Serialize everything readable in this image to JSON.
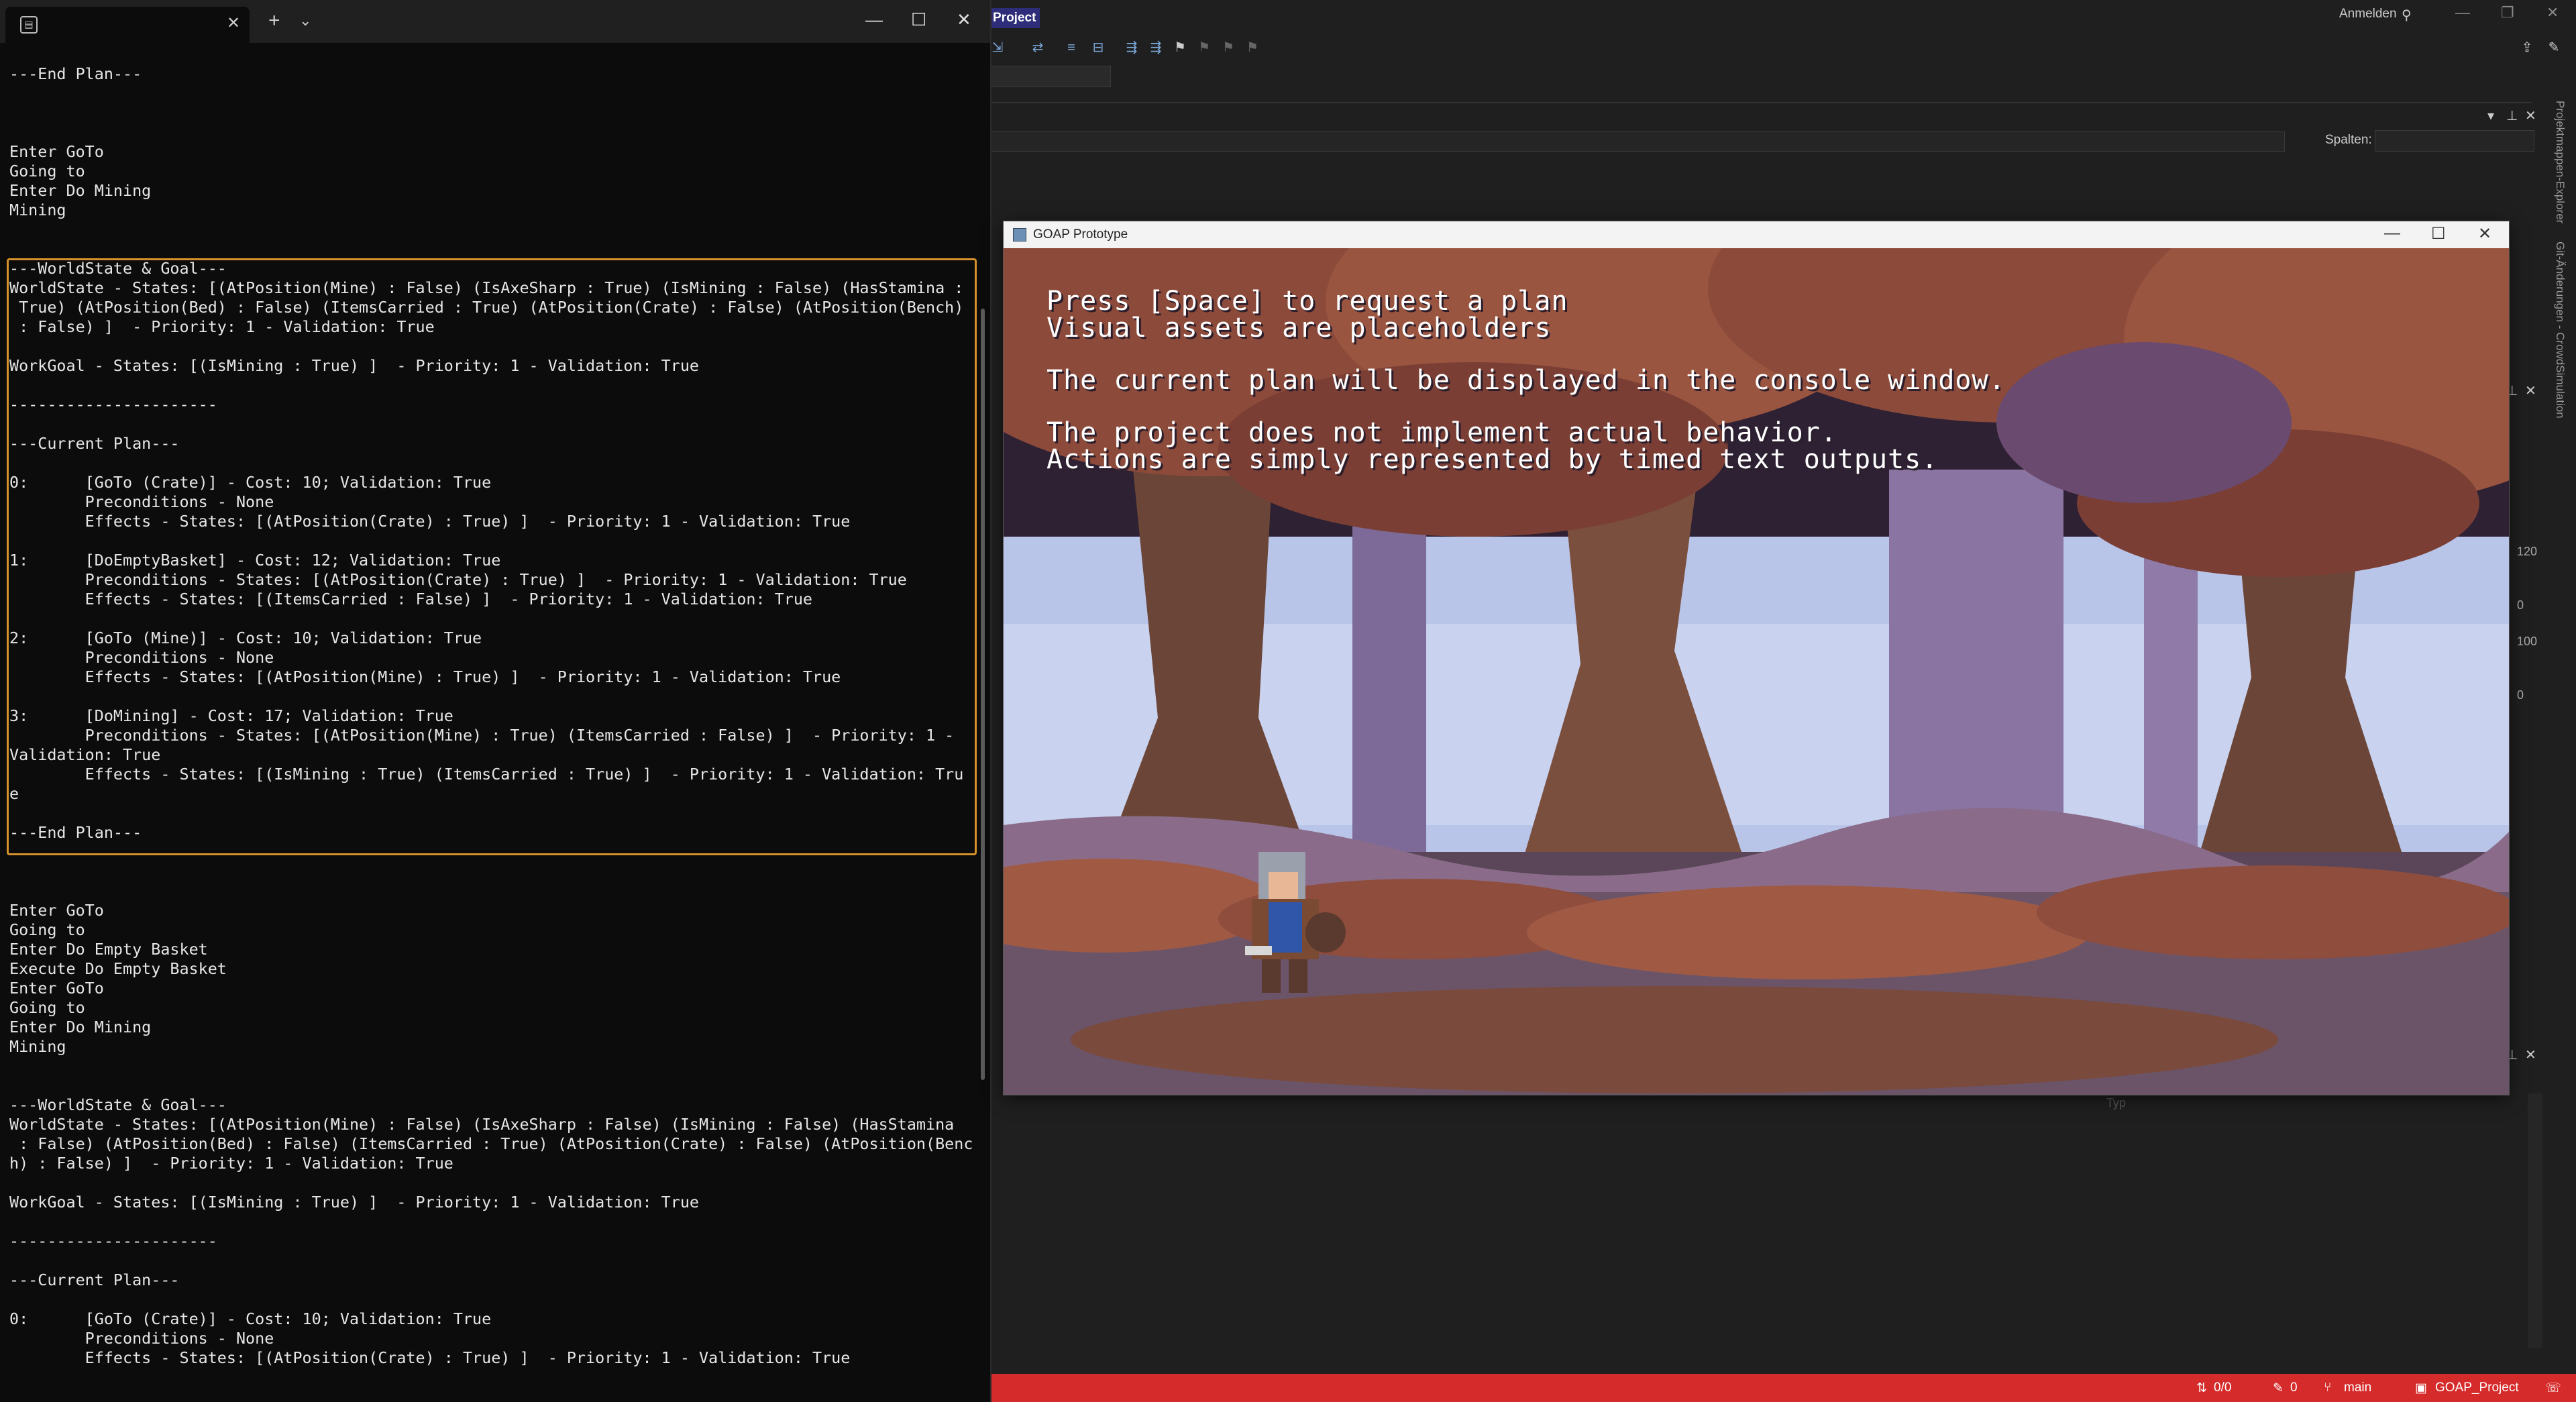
{
  "ide": {
    "project_chip": "Project",
    "signin": "Anmelden",
    "spalten_label": "Spalten:",
    "side_tab_1": "Projektmappen-Explorer",
    "side_tab_2": "Git-Änderungen - CrowdSimulation",
    "axis_values": [
      "120",
      "0",
      "100",
      "0"
    ],
    "bottom_placeholder": "Typ",
    "status": {
      "changes": "0/0",
      "edits": "0",
      "branch": "main",
      "project": "GOAP_Project"
    }
  },
  "terminal": {
    "tab_icon": "terminal-icon",
    "console_lines": [
      "---End Plan---",
      "",
      "",
      "",
      "Enter GoTo",
      "Going to",
      "Enter Do Mining",
      "Mining",
      "",
      "",
      "---WorldState & Goal---",
      "WorldState - States: [(AtPosition(Mine) : False) (IsAxeSharp : True) (IsMining : False) (HasStamina :",
      " True) (AtPosition(Bed) : False) (ItemsCarried : True) (AtPosition(Crate) : False) (AtPosition(Bench)",
      " : False) ]  - Priority: 1 - Validation: True",
      "",
      "WorkGoal - States: [(IsMining : True) ]  - Priority: 1 - Validation: True",
      "",
      "----------------------",
      "",
      "---Current Plan---",
      "",
      "0:      [GoTo (Crate)] - Cost: 10; Validation: True",
      "        Preconditions - None",
      "        Effects - States: [(AtPosition(Crate) : True) ]  - Priority: 1 - Validation: True",
      "",
      "1:      [DoEmptyBasket] - Cost: 12; Validation: True",
      "        Preconditions - States: [(AtPosition(Crate) : True) ]  - Priority: 1 - Validation: True",
      "        Effects - States: [(ItemsCarried : False) ]  - Priority: 1 - Validation: True",
      "",
      "2:      [GoTo (Mine)] - Cost: 10; Validation: True",
      "        Preconditions - None",
      "        Effects - States: [(AtPosition(Mine) : True) ]  - Priority: 1 - Validation: True",
      "",
      "3:      [DoMining] - Cost: 17; Validation: True",
      "        Preconditions - States: [(AtPosition(Mine) : True) (ItemsCarried : False) ]  - Priority: 1 -",
      "Validation: True",
      "        Effects - States: [(IsMining : True) (ItemsCarried : True) ]  - Priority: 1 - Validation: Tru",
      "e",
      "",
      "---End Plan---",
      "",
      "",
      "",
      "Enter GoTo",
      "Going to",
      "Enter Do Empty Basket",
      "Execute Do Empty Basket",
      "Enter GoTo",
      "Going to",
      "Enter Do Mining",
      "Mining",
      "",
      "",
      "---WorldState & Goal---",
      "WorldState - States: [(AtPosition(Mine) : False) (IsAxeSharp : False) (IsMining : False) (HasStamina",
      " : False) (AtPosition(Bed) : False) (ItemsCarried : True) (AtPosition(Crate) : False) (AtPosition(Benc",
      "h) : False) ]  - Priority: 1 - Validation: True",
      "",
      "WorkGoal - States: [(IsMining : True) ]  - Priority: 1 - Validation: True",
      "",
      "----------------------",
      "",
      "---Current Plan---",
      "",
      "0:      [GoTo (Crate)] - Cost: 10; Validation: True",
      "        Preconditions - None",
      "        Effects - States: [(AtPosition(Crate) : True) ]  - Priority: 1 - Validation: True"
    ]
  },
  "game": {
    "title": "GOAP Prototype",
    "messages": [
      "Press [Space] to request a plan",
      "Visual assets are placeholders",
      "",
      "The current plan will be displayed in the console window.",
      "",
      "The project does not implement actual behavior.",
      "Actions are simply represented by timed text outputs."
    ]
  }
}
